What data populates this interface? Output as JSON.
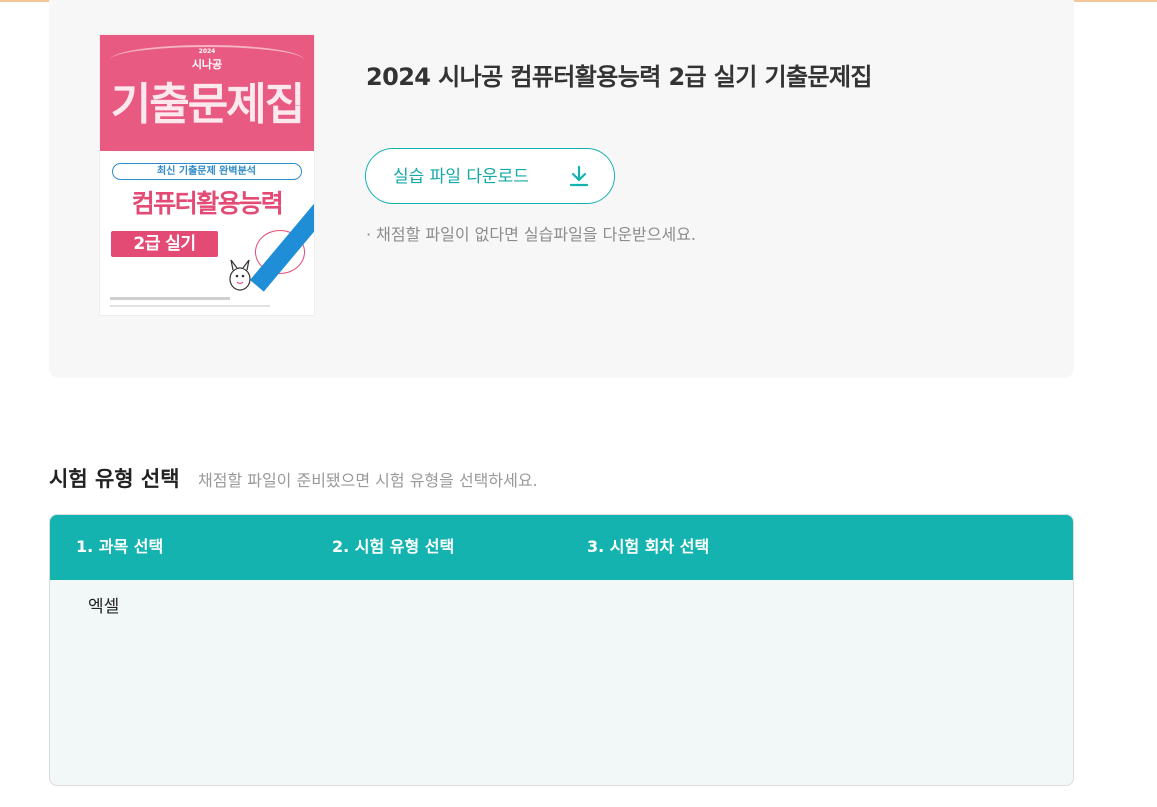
{
  "colors": {
    "accent": "#14b3b0",
    "accent_text": "#14a9a6",
    "panel_bg": "#f7f7f7",
    "selector_bg": "#f2f8f8",
    "cover_pink": "#e95a82",
    "cover_blue": "#2e8bc9"
  },
  "book": {
    "cover": {
      "year": "2024",
      "brand": "시나공",
      "title": "기출문제집",
      "subtitle": "최신 기출문제 완벽분석",
      "subject": "컴퓨터활용능력",
      "grade": "2급 실기"
    },
    "title": "2024 시나공 컴퓨터활용능력 2급 실기 기출문제집",
    "download_label": "실습 파일 다운로드",
    "download_icon": "download-icon",
    "note": "· 채점할 파일이 없다면 실습파일을 다운받으세요."
  },
  "exam_section": {
    "title": "시험 유형 선택",
    "description": "채점할 파일이 준비됐으면 시험 유형을 선택하세요.",
    "steps": [
      {
        "label": "1. 과목 선택"
      },
      {
        "label": "2. 시험 유형 선택"
      },
      {
        "label": "3. 시험 회차 선택"
      }
    ],
    "subjects": [
      {
        "label": "엑셀"
      }
    ]
  }
}
